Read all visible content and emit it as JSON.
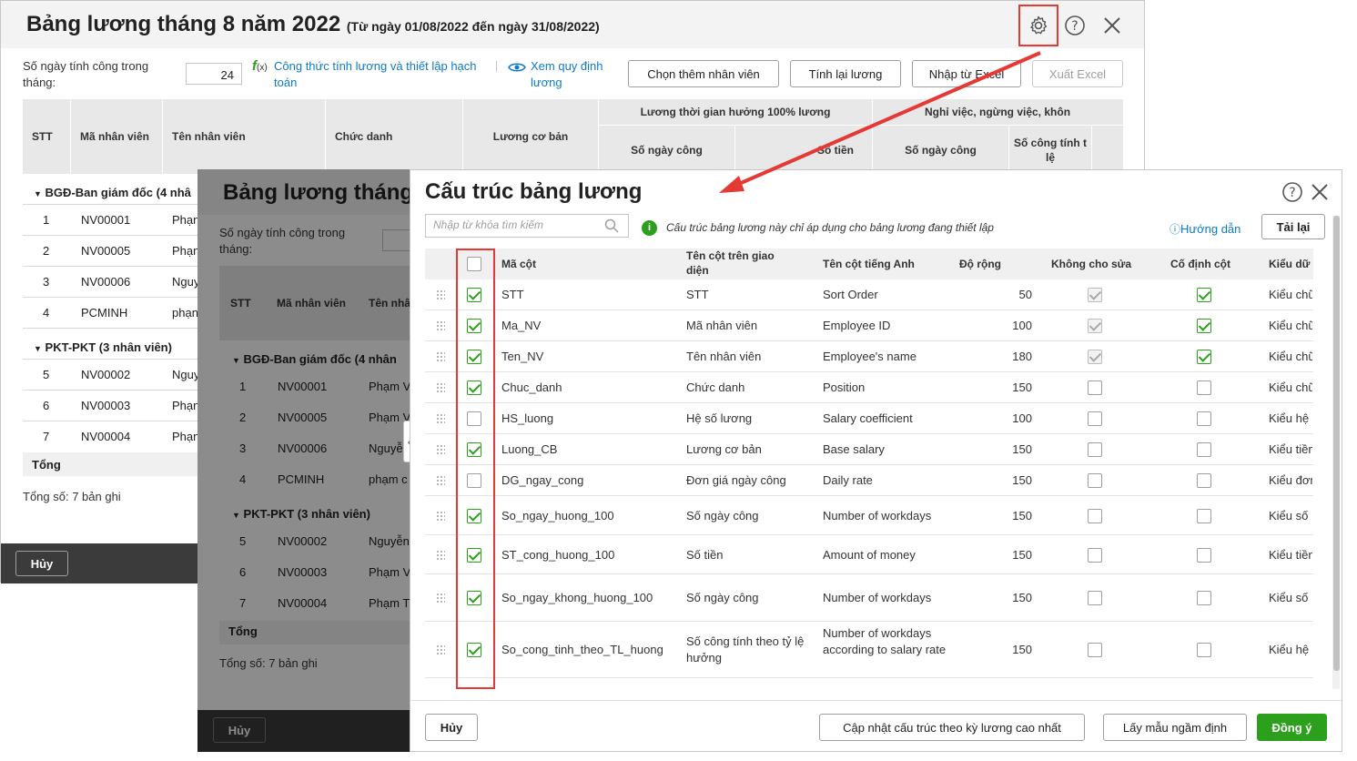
{
  "back": {
    "title": "Bảng lương tháng 8 năm 2022",
    "subtitle": "(Từ ngày 01/08/2022 đến ngày 31/08/2022)",
    "workdays_label": "Số ngày tính công trong tháng:",
    "workdays_value": "24",
    "formula_link": "Công thức tính lương và thiết lập hạch toán",
    "view_rules_link": "Xem quy định lương",
    "btn_add_employee": "Chọn thêm nhân viên",
    "btn_recalc": "Tính lại lương",
    "btn_import": "Nhập từ Excel",
    "btn_export": "Xuất Excel",
    "headers": {
      "stt": "STT",
      "code": "Mã nhân viên",
      "name": "Tên nhân viên",
      "position": "Chức danh",
      "base_salary": "Lương cơ bản",
      "group1": "Lương thời gian hưởng 100% lương",
      "g1_days": "Số ngày công",
      "g1_money": "Số tiền",
      "group2": "Nghỉ việc, ngừng việc, khôn",
      "g2_days": "Số ngày công",
      "g2_rate": "Số công tính t lệ"
    },
    "groups": [
      {
        "label": "BGĐ-Ban giám đốc (4 nhâ",
        "rows": [
          {
            "stt": "1",
            "code": "NV00001",
            "name": "Phạn"
          },
          {
            "stt": "2",
            "code": "NV00005",
            "name": "Phạn"
          },
          {
            "stt": "3",
            "code": "NV00006",
            "name": "Nguy"
          },
          {
            "stt": "4",
            "code": "PCMINH",
            "name": "phạn"
          }
        ]
      },
      {
        "label": "PKT-PKT (3 nhân viên)",
        "rows": [
          {
            "stt": "5",
            "code": "NV00002",
            "name": "Nguy"
          },
          {
            "stt": "6",
            "code": "NV00003",
            "name": "Phạn"
          },
          {
            "stt": "7",
            "code": "NV00004",
            "name": "Phạn"
          }
        ]
      }
    ],
    "total_label": "Tổng",
    "record_count": "Tổng số: 7 bản ghi",
    "cancel": "Hủy"
  },
  "mid": {
    "title": "Bảng lương tháng",
    "workdays_label": "Số ngày tính công trong tháng:",
    "headers": {
      "stt": "STT",
      "code": "Mã nhân viên",
      "name": "Tên nhâ"
    },
    "groups": [
      {
        "label": "BGĐ-Ban giám đốc (4 nhân",
        "rows": [
          {
            "stt": "1",
            "code": "NV00001",
            "name": "Phạm V"
          },
          {
            "stt": "2",
            "code": "NV00005",
            "name": "Phạm V"
          },
          {
            "stt": "3",
            "code": "NV00006",
            "name": "Nguyễ"
          },
          {
            "stt": "4",
            "code": "PCMINH",
            "name": "phạm c"
          }
        ]
      },
      {
        "label": "PKT-PKT (3 nhân viên)",
        "rows": [
          {
            "stt": "5",
            "code": "NV00002",
            "name": "Nguyễn"
          },
          {
            "stt": "6",
            "code": "NV00003",
            "name": "Phạm V"
          },
          {
            "stt": "7",
            "code": "NV00004",
            "name": "Phạm T"
          }
        ]
      }
    ],
    "total_label": "Tổng",
    "record_count": "Tổng số: 7 bản ghi",
    "cancel": "Hủy"
  },
  "dialog": {
    "title": "Cấu trúc bảng lương",
    "search_placeholder": "Nhập từ khóa tìm kiếm",
    "info": "Cấu trúc bảng lương này chỉ áp dụng cho bảng lương đang thiết lập",
    "help_link": "Hướng dẫn",
    "reload": "Tải lại",
    "columns": {
      "code": "Mã cột",
      "ui_name": "Tên cột trên giao diện",
      "en_name": "Tên cột tiếng Anh",
      "width": "Độ rộng",
      "no_edit": "Không cho sửa",
      "pinned": "Cố định cột",
      "type": "Kiểu dữ"
    },
    "rows": [
      {
        "checked": true,
        "code": "STT",
        "ui": "STT",
        "en": "Sort Order",
        "width": "50",
        "no_edit": "locked",
        "pinned": true,
        "type": "Kiểu chữ"
      },
      {
        "checked": true,
        "code": "Ma_NV",
        "ui": "Mã nhân viên",
        "en": "Employee ID",
        "width": "100",
        "no_edit": "locked",
        "pinned": true,
        "type": "Kiểu chữ"
      },
      {
        "checked": true,
        "code": "Ten_NV",
        "ui": "Tên nhân viên",
        "en": "Employee's name",
        "width": "180",
        "no_edit": "locked",
        "pinned": true,
        "type": "Kiểu chữ"
      },
      {
        "checked": true,
        "code": "Chuc_danh",
        "ui": "Chức danh",
        "en": "Position",
        "width": "150",
        "no_edit": "off",
        "pinned": false,
        "type": "Kiểu chữ"
      },
      {
        "checked": false,
        "code": "HS_luong",
        "ui": "Hệ số lương",
        "en": "Salary coefficient",
        "width": "100",
        "no_edit": "off",
        "pinned": false,
        "type": "Kiểu hệ"
      },
      {
        "checked": true,
        "code": "Luong_CB",
        "ui": "Lương cơ bản",
        "en": "Base salary",
        "width": "150",
        "no_edit": "off",
        "pinned": false,
        "type": "Kiểu tiền"
      },
      {
        "checked": false,
        "code": "DG_ngay_cong",
        "ui": "Đơn giá ngày công",
        "en": "Daily rate",
        "width": "150",
        "no_edit": "off",
        "pinned": false,
        "type": "Kiểu đơn"
      },
      {
        "checked": true,
        "code": "So_ngay_huong_100",
        "ui": "Số ngày công",
        "en": "Number of workdays",
        "width": "150",
        "no_edit": "off",
        "pinned": false,
        "type": "Kiểu số"
      },
      {
        "checked": true,
        "code": "ST_cong_huong_100",
        "ui": "Số tiền",
        "en": "Amount of money",
        "width": "150",
        "no_edit": "off",
        "pinned": false,
        "type": "Kiểu tiền"
      },
      {
        "checked": true,
        "code": "So_ngay_khong_huong_100",
        "ui": "Số ngày công",
        "en": "Number of workdays",
        "width": "150",
        "no_edit": "off",
        "pinned": false,
        "type": "Kiểu số"
      },
      {
        "checked": true,
        "code": "So_cong_tinh_theo_TL_huong",
        "ui": "Số công tính theo tỷ lệ hưởng",
        "en": "Number of workdays according to salary rate",
        "width": "150",
        "no_edit": "off",
        "pinned": false,
        "type": "Kiểu hệ"
      }
    ],
    "btn_cancel": "Hủy",
    "btn_update": "Cập nhật cấu trúc theo kỳ lương cao nhất",
    "btn_default": "Lấy mẫu ngầm định",
    "btn_ok": "Đồng ý"
  },
  "colors": {
    "accent_green": "#2ca01c",
    "link_blue": "#0f7bc1",
    "annotation_red": "#e53935"
  }
}
